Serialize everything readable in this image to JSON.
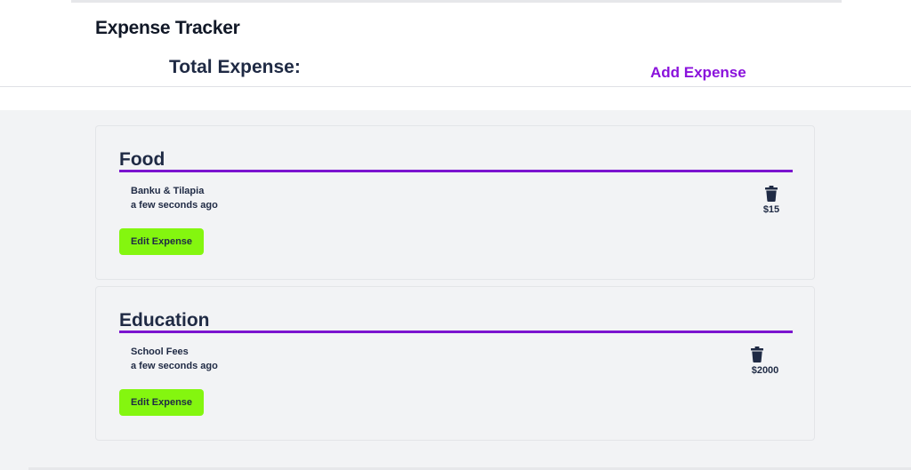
{
  "header": {
    "app_title": "Expense Tracker",
    "total_label": "Total Expense:",
    "add_expense_link": "Add Expense"
  },
  "categories": [
    {
      "title": "Food",
      "items": [
        {
          "name": "Banku & Tilapia",
          "time": "a few seconds ago",
          "amount": "$15",
          "edit_label": "Edit Expense"
        }
      ]
    },
    {
      "title": "Education",
      "items": [
        {
          "name": "School Fees",
          "time": "a few seconds ago",
          "amount": "$2000",
          "edit_label": "Edit Expense"
        }
      ]
    }
  ],
  "colors": {
    "accent": "#8a12dc",
    "category_rule": "#7b14cf",
    "edit_button": "#84f60f",
    "text": "#1f2a44",
    "background": "#f2f3f5"
  },
  "icons": {
    "delete": "trash-icon"
  }
}
